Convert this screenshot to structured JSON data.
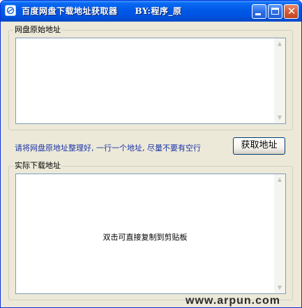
{
  "window": {
    "title": "百度网盘下载地址获取器　　BY:程序_原",
    "close_glyph": "✕"
  },
  "source_group": {
    "label": "网盘原始地址",
    "input_value": ""
  },
  "hint": {
    "text": "请将网盘原地址整理好, 一行一个地址, 尽量不要有空行"
  },
  "fetch_button": {
    "label": "获取地址"
  },
  "result_group": {
    "label": "实际下载地址",
    "message": "双击可直接复制到剪贴板"
  },
  "scroll": {
    "up_glyph": "▲",
    "down_glyph": "▼"
  },
  "watermark": {
    "text": "www.arpun.com"
  },
  "colors": {
    "titlebar": "#0054e3",
    "window_bg": "#ece9d8",
    "hint_text": "#1c35a8"
  },
  "icons": {
    "app": "app-logo-icon",
    "minimize": "minimize-icon",
    "maximize": "maximize-icon",
    "close": "close-icon"
  }
}
